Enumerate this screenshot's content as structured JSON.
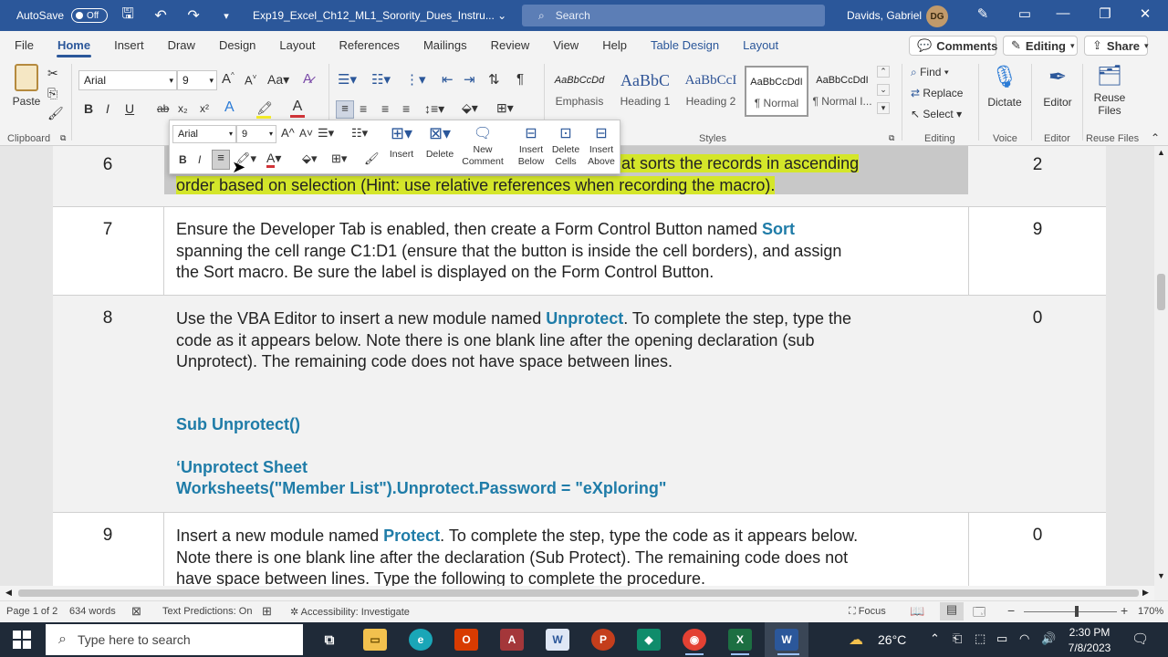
{
  "titlebar": {
    "autosave_label": "AutoSave",
    "autosave_state": "Off",
    "doc_title": "Exp19_Excel_Ch12_ML1_Sorority_Dues_Instru...",
    "search_placeholder": "Search",
    "user_name": "Davids, Gabriel",
    "user_initials": "DG"
  },
  "tabs": [
    "File",
    "Home",
    "Insert",
    "Draw",
    "Design",
    "Layout",
    "References",
    "Mailings",
    "Review",
    "View",
    "Help",
    "Table Design",
    "Layout"
  ],
  "tab_actions": {
    "comments": "Comments",
    "editing": "Editing",
    "share": "Share"
  },
  "ribbon": {
    "paste": "Paste",
    "clipboard": "Clipboard",
    "font_name": "Arial",
    "font_size": "9",
    "styles_label": "Styles",
    "styles": [
      {
        "sample": "AaBbCcDd",
        "name": "Emphasis"
      },
      {
        "sample": "AaBbC",
        "name": "Heading 1"
      },
      {
        "sample": "AaBbCcI",
        "name": "Heading 2"
      },
      {
        "sample": "AaBbCcDdI",
        "name": "¶ Normal"
      },
      {
        "sample": "AaBbCcDdI",
        "name": "¶ Normal I..."
      }
    ],
    "find": "Find",
    "replace": "Replace",
    "select": "Select",
    "editing_label": "Editing",
    "dictate": "Dictate",
    "voice_label": "Voice",
    "editor": "Editor",
    "editor_label": "Editor",
    "reuse_files": "Reuse Files",
    "reuse_label": "Reuse Files"
  },
  "mini_toolbar": {
    "font_name": "Arial",
    "font_size": "9",
    "insert": "Insert",
    "delete": "Delete",
    "new_comment": "New Comment",
    "insert_below": "Insert Below",
    "delete_cells": "Delete Cells",
    "insert_above": "Insert Above"
  },
  "rows": [
    {
      "num": "6",
      "score": "2",
      "text_pre": "",
      "text_hl_visible": "rt",
      "text_post": " that sorts the records in ascending",
      "line2": "order based on selection (Hint: use relative references when recording the macro)."
    },
    {
      "num": "7",
      "score": "9",
      "text_pre": "Ensure the Developer Tab is enabled, then create a Form Control Button named ",
      "text_hl": "Sort",
      "line2": "spanning the cell range C1:D1 (ensure that the button is inside the cell borders), and assign",
      "line3": "the Sort macro. Be sure the label is displayed on the Form Control Button."
    },
    {
      "num": "8",
      "score": "0",
      "text_pre": "Use the VBA Editor to insert a new module named ",
      "text_hl": "Unprotect",
      "text_post": ". To complete the step, type the",
      "line2": "code as it appears below. Note there is one blank line after the opening declaration (sub",
      "line3": "Unprotect). The remaining code does not have space between lines.",
      "code1": "Sub Unprotect()",
      "code2": "‘Unprotect Sheet",
      "code3": "Worksheets(\"Member List\").Unprotect.Password = \"eXploring\""
    },
    {
      "num": "9",
      "score": "0",
      "text_pre": "Insert a new module named ",
      "text_hl": "Protect",
      "text_post": ". To complete the step, type the code as it appears below.",
      "line2": "Note there is one blank line after the declaration (Sub Protect). The remaining code does not",
      "line3": "have space between lines. Type the following to complete the procedure."
    }
  ],
  "statusbar": {
    "page": "Page 1 of 2",
    "words": "634 words",
    "predictions": "Text Predictions: On",
    "accessibility": "Accessibility: Investigate",
    "focus": "Focus",
    "zoom": "170%"
  },
  "taskbar": {
    "search_placeholder": "Type here to search",
    "temperature": "26°C",
    "time": "2:30 PM",
    "date": "7/8/2023"
  },
  "colors": {
    "word_blue": "#2b579a",
    "highlight_yellow": "#d4e62a",
    "code_blue": "#1f7ca8"
  }
}
